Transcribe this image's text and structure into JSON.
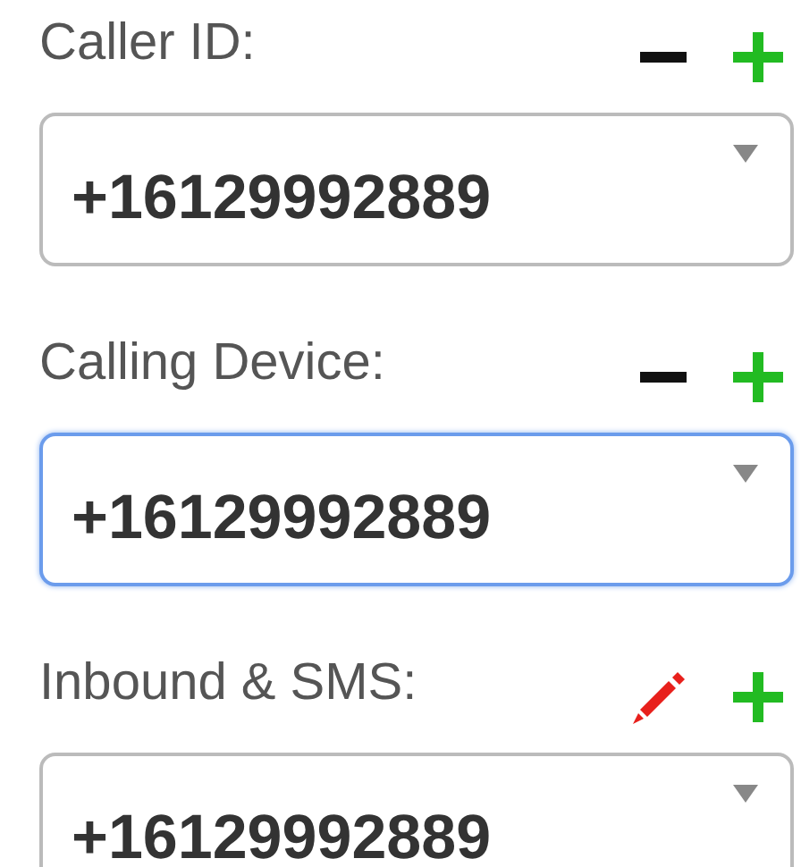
{
  "fields": [
    {
      "label": "Caller ID:",
      "actions": [
        {
          "kind": "remove"
        },
        {
          "kind": "add"
        }
      ],
      "value": "+16129992889",
      "focused": false
    },
    {
      "label": "Calling Device:",
      "actions": [
        {
          "kind": "remove"
        },
        {
          "kind": "add"
        }
      ],
      "value": "+16129992889",
      "focused": true
    },
    {
      "label": "Inbound & SMS:",
      "actions": [
        {
          "kind": "edit"
        },
        {
          "kind": "add"
        }
      ],
      "value": "+16129992889",
      "focused": false
    }
  ]
}
